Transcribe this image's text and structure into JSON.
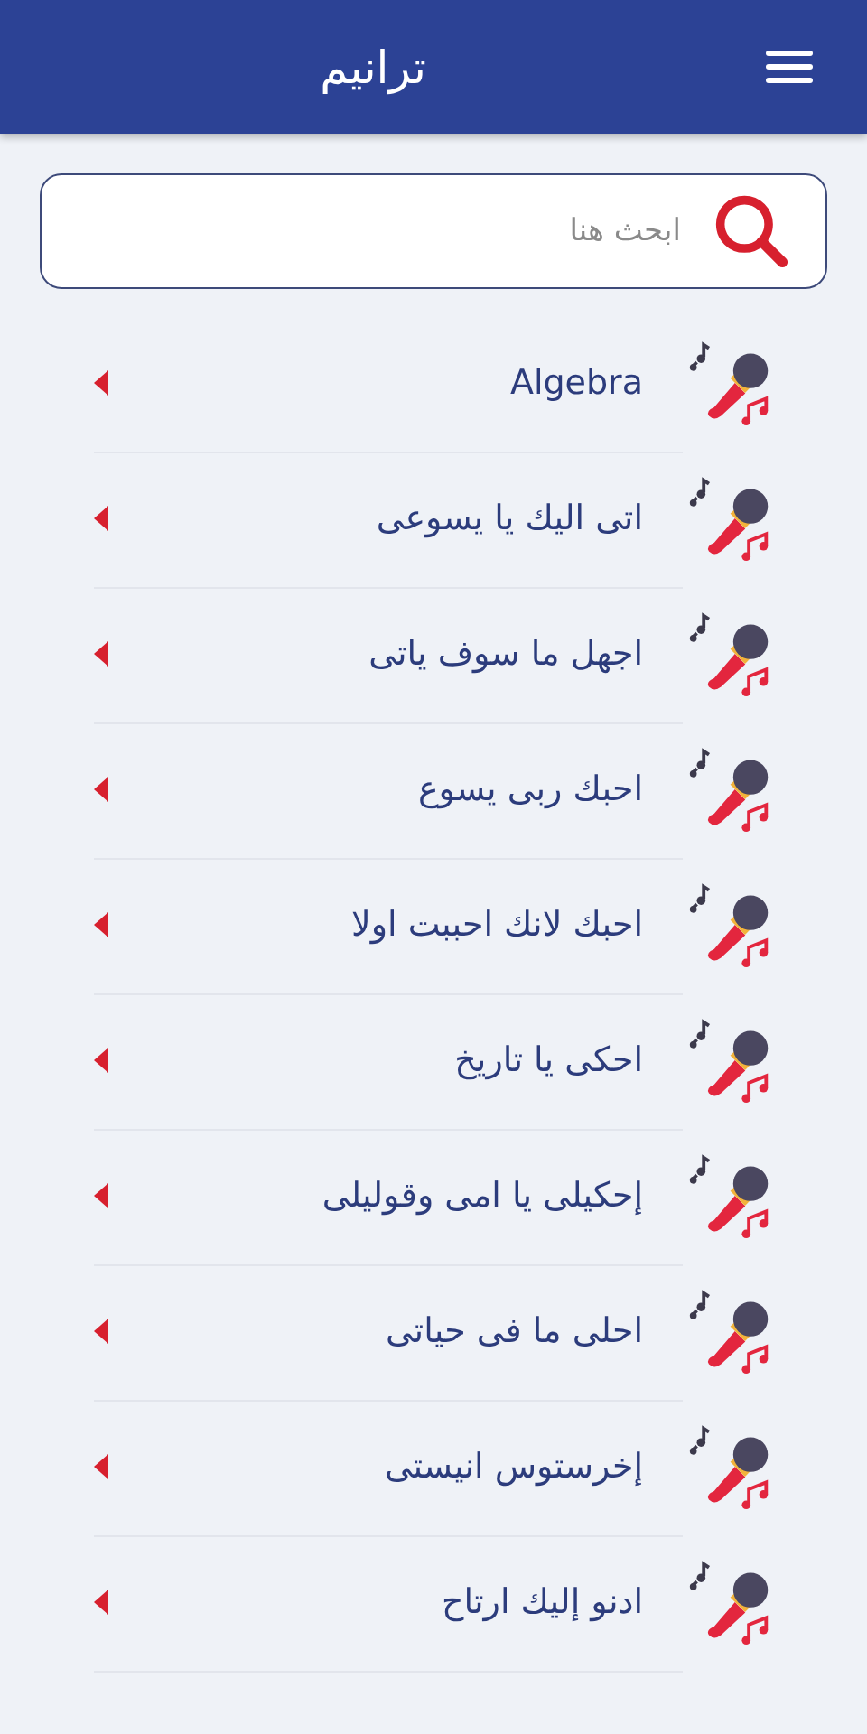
{
  "header": {
    "title": "ترانيم"
  },
  "search": {
    "placeholder": "ابحث هنا"
  },
  "songs": [
    {
      "title": "Algebra"
    },
    {
      "title": "اتى اليك يا يسوعى"
    },
    {
      "title": "اجهل ما سوف ياتى"
    },
    {
      "title": "احبك ربى يسوع"
    },
    {
      "title": "احبك لانك احببت اولا"
    },
    {
      "title": "احكى يا تاريخ"
    },
    {
      "title": "إحكيلى يا امى وقوليلى"
    },
    {
      "title": "احلى ما فى حياتى"
    },
    {
      "title": "إخرستوس انيستى"
    },
    {
      "title": "ادنو إليك ارتاح"
    }
  ]
}
